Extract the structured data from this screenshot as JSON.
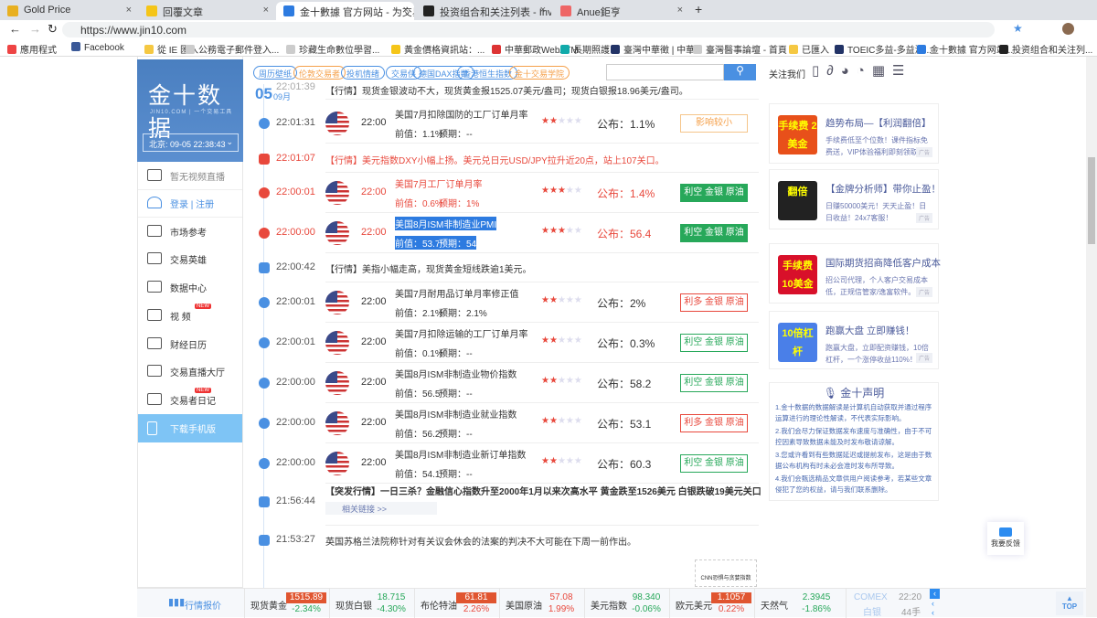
{
  "browser": {
    "tabs": [
      {
        "label": "Gold Price",
        "color": "#e8b020"
      },
      {
        "label": "回覆文章",
        "color": "#f5c518"
      },
      {
        "label": "金十數據 官方网站 - 为交易而生",
        "color": "#2d7be0"
      },
      {
        "label": "投资组合和关注列表 - Investing",
        "color": "#222"
      },
      {
        "label": "Anue鉅亨",
        "color": "#e66"
      }
    ],
    "url": "https://www.jin10.com",
    "bookmarks": [
      {
        "label": "應用程式",
        "color": "#e44"
      },
      {
        "label": "Facebook",
        "color": "#3b5998"
      },
      {
        "label": "從 IE 匯入",
        "color": "#f5c842"
      },
      {
        "label": "公務電子郵件登入...",
        "color": "#ccc"
      },
      {
        "label": "珍藏生命數位學習...",
        "color": "#ccc"
      },
      {
        "label": "黃金價格資訊站：...",
        "color": "#f5c518"
      },
      {
        "label": "中華郵政WebATM",
        "color": "#d33"
      },
      {
        "label": "長期照護",
        "color": "#1aa"
      },
      {
        "label": "臺灣中華徵 | 中華...",
        "color": "#236"
      },
      {
        "label": "臺灣醫事論壇 - 首頁",
        "color": "#ccc"
      },
      {
        "label": "已匯入",
        "color": "#f5c842"
      },
      {
        "label": "TOEIC多益-多益測...",
        "color": "#236"
      },
      {
        "label": "金十數據 官方网站...",
        "color": "#2d7be0"
      },
      {
        "label": "投资组合和关注列...",
        "color": "#222"
      }
    ]
  },
  "logo": {
    "title": "金十数据",
    "sub": "JIN10.COM | 一个交易工具",
    "clock": "北京: 09-05 22:38:43"
  },
  "nav": [
    {
      "label": "暂无视频直播"
    },
    {
      "label": "登录 | 注册"
    },
    {
      "label": "市场参考"
    },
    {
      "label": "交易英雄"
    },
    {
      "label": "数据中心"
    },
    {
      "label": "视 频",
      "new": "NEW"
    },
    {
      "label": "财经日历"
    },
    {
      "label": "交易直播大厅"
    },
    {
      "label": "交易者日记",
      "new": "NEW"
    },
    {
      "label": "下载手机版"
    }
  ],
  "chips": [
    {
      "label": "周历壁纸"
    },
    {
      "label": "伦敦交易者",
      "orange": true
    },
    {
      "label": "投机情绪"
    },
    {
      "label": "交易侠"
    },
    {
      "label": "德国DAX指数"
    },
    {
      "label": "香港恒生指数"
    },
    {
      "label": "金十交易学院",
      "orange": true
    }
  ],
  "search": {
    "placeholder": ""
  },
  "follow": {
    "label": "关注我们"
  },
  "date": {
    "day": "05",
    "month": "09月"
  },
  "feed": [
    {
      "type": "news",
      "time": "22:01:39",
      "text": "【行情】现货金银波动不大，现货黄金报1525.07美元/盎司；现货白银报18.96美元/盎司。"
    },
    {
      "type": "data",
      "time": "22:01:31",
      "rel": "22:00",
      "title": "美国7月扣除国防的工厂订单月率",
      "prev": "前值：1.1%",
      "fc": "预期：--",
      "stars": 2,
      "actual": "公布：1.1%",
      "badge": "影响较小",
      "style": "minor"
    },
    {
      "type": "news",
      "time": "22:01:07",
      "text": "【行情】美元指数DXY小幅上扬。美元兑日元USD/JPY拉升近20点，站上107关口。",
      "red": true
    },
    {
      "type": "data",
      "time": "22:00:01",
      "rel": "22:00",
      "title": "美国7月工厂订单月率",
      "prev": "前值：0.6%",
      "fc": "预期：1%",
      "stars": 3,
      "actual": "公布：1.4%",
      "badge": "利空 金银 原油",
      "style": "solidgreen",
      "red": true
    },
    {
      "type": "data",
      "time": "22:00:00",
      "rel": "22:00",
      "title": "美国8月ISM非制造业PMI",
      "prev": "前值：53.7",
      "fc": "预期：54",
      "stars": 3,
      "actual": "公布：56.4",
      "badge": "利空 金银 原油",
      "style": "solidgreen",
      "red": true,
      "selected": true
    },
    {
      "type": "news",
      "time": "22:00:42",
      "text": "【行情】美指小幅走高，现货黄金短线跌逾1美元。"
    },
    {
      "type": "data",
      "time": "22:00:01",
      "rel": "22:00",
      "title": "美国7月耐用品订单月率修正值",
      "prev": "前值：2.1%",
      "fc": "预期：2.1%",
      "stars": 2,
      "actual": "公布：2%",
      "badge": "利多 金银 原油",
      "style": "red"
    },
    {
      "type": "data",
      "time": "22:00:01",
      "rel": "22:00",
      "title": "美国7月扣除运输的工厂订单月率",
      "prev": "前值：0.1%",
      "fc": "预期：--",
      "stars": 2,
      "actual": "公布：0.3%",
      "badge": "利空 金银 原油",
      "style": "green"
    },
    {
      "type": "data",
      "time": "22:00:00",
      "rel": "22:00",
      "title": "美国8月ISM非制造业物价指数",
      "prev": "前值：56.5",
      "fc": "预期：--",
      "stars": 2,
      "actual": "公布：58.2",
      "badge": "利空 金银 原油",
      "style": "green"
    },
    {
      "type": "data",
      "time": "22:00:00",
      "rel": "22:00",
      "title": "美国8月ISM非制造业就业指数",
      "prev": "前值：56.2",
      "fc": "预期：--",
      "stars": 2,
      "actual": "公布：53.1",
      "badge": "利多 金银 原油",
      "style": "red"
    },
    {
      "type": "data",
      "time": "22:00:00",
      "rel": "22:00",
      "title": "美国8月ISM非制造业新订单指数",
      "prev": "前值：54.1",
      "fc": "预期：--",
      "stars": 2,
      "actual": "公布：60.3",
      "badge": "利空 金银 原油",
      "style": "green"
    },
    {
      "type": "bignews",
      "time": "21:56:44",
      "text": "【突发行情】一日三杀？金融信心指数升至2000年1月以来次高水平 黄金跌至1526美元 白银跌破19美元关口",
      "link": "相关链接 >>"
    },
    {
      "type": "news",
      "time": "21:53:27",
      "text": "英国苏格兰法院称针对有关议会休会的法案的判决不大可能在下周一前作出。"
    }
  ],
  "promo": {
    "text": "CNN恐惧与贪婪指数"
  },
  "ads": [
    {
      "img": "手续费 2美金",
      "bg": "#e8501a",
      "title": "趋势布局—【利润翻倍】",
      "desc": "手续费低至个位数！课件指标免费送，VIP体验福利即刻领取",
      "tag": "广告"
    },
    {
      "img": "翻倍",
      "bg": "#222",
      "title": "【金牌分析师】带你止盈！",
      "desc": "日赚50000美元！天天止盈！日日收益！24x7客服！",
      "tag": "广告"
    },
    {
      "img": "手续费 10美金",
      "bg": "#d8102a",
      "title": "国际期货招商降低客户成本",
      "desc": "招公司代理，个人客户交易成本低，正规信管家/逸富软件。",
      "tag": "广告"
    },
    {
      "img": "10倍杠杆",
      "bg": "#4a7fe8",
      "title": "跑赢大盘 立即赚钱！",
      "desc": "跑赢大盘，立即配资赚钱，10倍杠杆，一个涨停收益110%！",
      "tag": "广告"
    }
  ],
  "statement": {
    "title": "金十声明",
    "items": [
      "1.金十数据的数据解读是计算机自动获取并通过程序运算进行的理论性解读，不代表实际影响。",
      "2.我们会尽力保证数据发布速度与准确性，由于不可控因素导致数据未能及时发布敬请谅解。",
      "3.您或许看到有些数据延迟或提前发布，这是由于数据公布机构有时未必会准时发布所导致。",
      "4.我们会甄选精品文章供用户阅读参考，若某些文章侵犯了您的权益，请与我们联系删除。"
    ]
  },
  "feedback": {
    "label": "我要反馈"
  },
  "top": {
    "label": "TOP"
  },
  "ticker": {
    "title": "行情报价",
    "items": [
      {
        "name": "现货黄金",
        "price": "1515.89",
        "change": "-2.34%",
        "dir": "down",
        "hl": true
      },
      {
        "name": "现货白银",
        "price": "18.715",
        "change": "-4.30%",
        "dir": "down"
      },
      {
        "name": "布伦特油",
        "price": "61.81",
        "change": "2.26%",
        "dir": "up",
        "hl": true
      },
      {
        "name": "美国原油",
        "price": "57.08",
        "change": "1.99%",
        "dir": "up"
      },
      {
        "name": "美元指数",
        "price": "98.340",
        "change": "-0.06%",
        "dir": "down"
      },
      {
        "name": "欧元美元",
        "price": "1.1057",
        "change": "0.22%",
        "dir": "up",
        "hl": true
      },
      {
        "name": "天然气",
        "price": "2.3945",
        "change": "-1.86%",
        "dir": "down"
      }
    ],
    "comex": {
      "a": "COMEX",
      "b": "白银",
      "time": "22:20",
      "vol": "44手"
    }
  },
  "colors": {
    "blue": "#4a90e2",
    "red": "#e8483c",
    "green": "#27a85a"
  }
}
